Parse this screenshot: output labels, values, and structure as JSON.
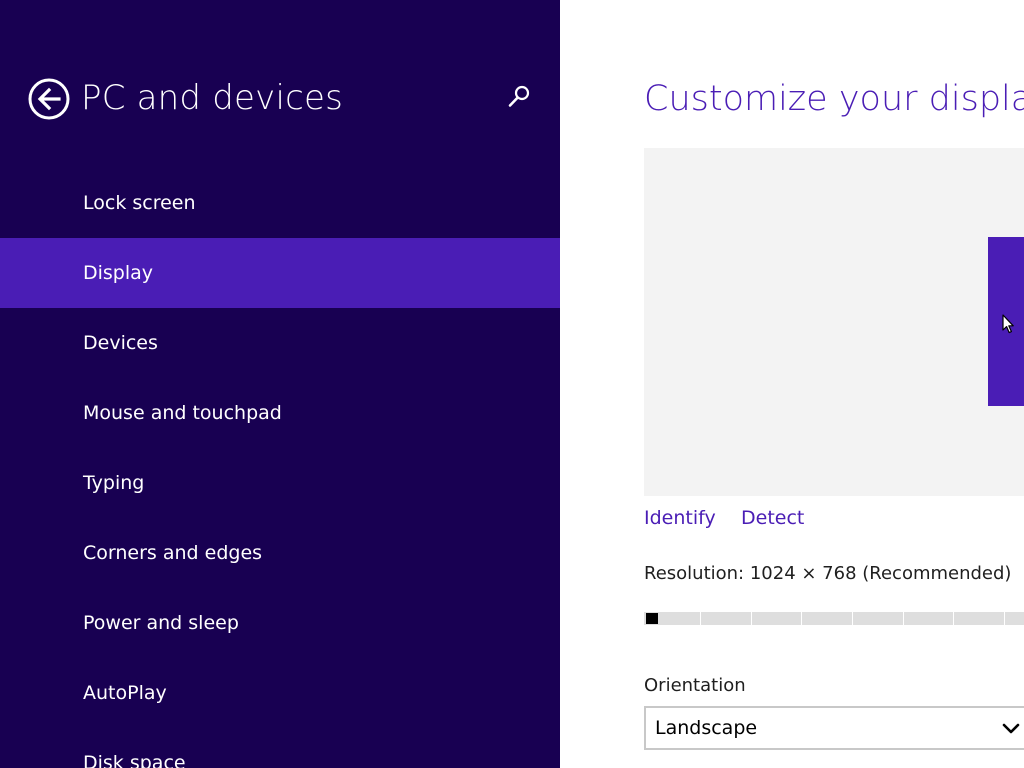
{
  "nav": {
    "back_icon": "back-arrow-circle-icon",
    "title": "PC and devices",
    "search_icon": "search-icon",
    "items": [
      {
        "label": "Lock screen"
      },
      {
        "label": "Display"
      },
      {
        "label": "Devices"
      },
      {
        "label": "Mouse and touchpad"
      },
      {
        "label": "Typing"
      },
      {
        "label": "Corners and edges"
      },
      {
        "label": "Power and sleep"
      },
      {
        "label": "AutoPlay"
      },
      {
        "label": "Disk space"
      }
    ],
    "selected": "Display"
  },
  "main": {
    "title": "Customize your display",
    "identify_link": "Identify",
    "detect_link": "Detect",
    "resolution_text": "Resolution: 1024 × 768 (Recommended)",
    "resolution_slider": {
      "position": 0
    },
    "orientation": {
      "label": "Orientation",
      "selected": "Landscape",
      "chevron_icon": "chevron-down-icon"
    }
  },
  "colors": {
    "nav_background": "#180052",
    "accent": "#4a1db5",
    "preview_background": "#f3f3f3"
  }
}
